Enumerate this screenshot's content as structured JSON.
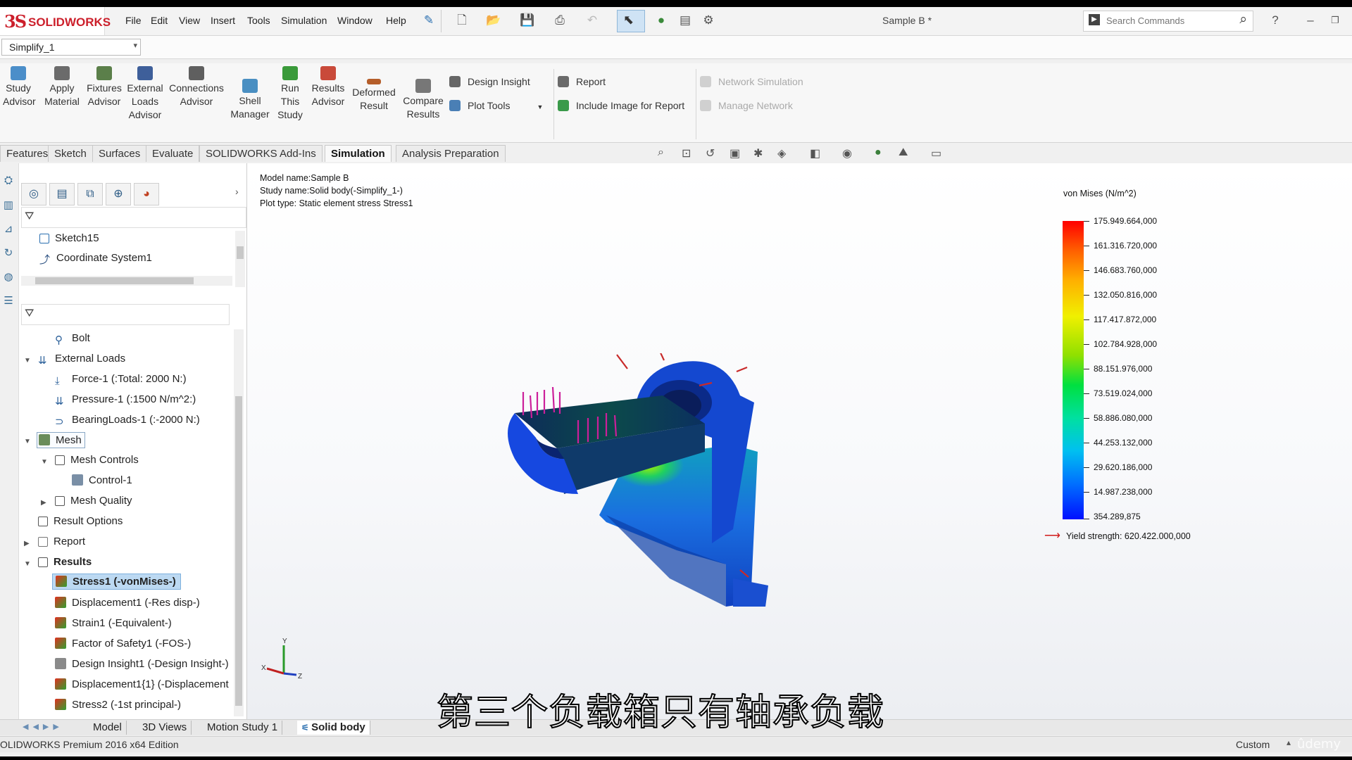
{
  "app": {
    "name": "SOLIDWORKS",
    "title": "Sample B *"
  },
  "menu": [
    "File",
    "Edit",
    "View",
    "Insert",
    "Tools",
    "Simulation",
    "Window",
    "Help"
  ],
  "search": {
    "placeholder": "Search Commands"
  },
  "config": {
    "selected": "Simplify_1"
  },
  "ribbon": {
    "study_advisor": "Study\nAdvisor",
    "apply_material": "Apply\nMaterial",
    "fixtures_advisor": "Fixtures\nAdvisor",
    "external_loads_advisor": "External\nLoads\nAdvisor",
    "connections_advisor": "Connections\nAdvisor",
    "shell_manager": "Shell\nManager",
    "run_this_study": "Run\nThis\nStudy",
    "results_advisor": "Results\nAdvisor",
    "deformed_result": "Deformed\nResult",
    "compare_results": "Compare\nResults",
    "design_insight": "Design Insight",
    "plot_tools": "Plot Tools",
    "report": "Report",
    "include_image": "Include Image for Report",
    "network_simulation": "Network Simulation",
    "manage_network": "Manage Network"
  },
  "command_tabs": [
    "Features",
    "Sketch",
    "Surfaces",
    "Evaluate",
    "SOLIDWORKS Add-Ins",
    "Simulation",
    "Analysis Preparation"
  ],
  "active_command_tab": "Simulation",
  "feature_tree": {
    "items": [
      "Sketch15",
      "Coordinate System1"
    ]
  },
  "sim_tree": {
    "bolt": "Bolt",
    "external_loads": "External Loads",
    "force": "Force-1 (:Total: 2000 N:)",
    "pressure": "Pressure-1 (:1500 N/m^2:)",
    "bearing": "BearingLoads-1 (:-2000 N:)",
    "mesh": "Mesh",
    "mesh_controls": "Mesh Controls",
    "control1": "Control-1",
    "mesh_quality": "Mesh Quality",
    "result_options": "Result Options",
    "report": "Report",
    "results": "Results",
    "stress1": "Stress1 (-vonMises-)",
    "displacement1": "Displacement1 (-Res disp-)",
    "strain1": "Strain1 (-Equivalent-)",
    "fos1": "Factor of Safety1 (-FOS-)",
    "design_insight1": "Design Insight1 (-Design Insight-)",
    "displacement1_1": "Displacement1{1} (-Displacement",
    "stress2": "Stress2 (-1st principal-)"
  },
  "plot_info": {
    "model": "Model name:Sample B",
    "study": "Study name:Solid body(-Simplify_1-)",
    "plot_type": "Plot type: Static element stress Stress1"
  },
  "legend": {
    "title": "von Mises (N/m^2)",
    "values": [
      "175.949.664,000",
      "161.316.720,000",
      "146.683.760,000",
      "132.050.816,000",
      "117.417.872,000",
      "102.784.928,000",
      "88.151.976,000",
      "73.519.024,000",
      "58.886.080,000",
      "44.253.132,000",
      "29.620.186,000",
      "14.987.238,000",
      "354.289,875"
    ],
    "yield": "Yield strength: 620.422.000,000"
  },
  "bottom_tabs": [
    "Model",
    "3D Views",
    "Motion Study 1",
    "Solid body"
  ],
  "active_bottom_tab": "Solid body",
  "status": {
    "edition": "OLIDWORKS Premium 2016 x64 Edition",
    "units": "Custom"
  },
  "subtitle": "第三个负载箱只有轴承负载",
  "watermark": "ûdemy",
  "colors": {
    "brand": "#cc1f2b",
    "selection": "#bcd9f2",
    "load_arrow": "#cc1f9a",
    "stress_max": "#ff0000",
    "stress_min": "#0010ff"
  }
}
